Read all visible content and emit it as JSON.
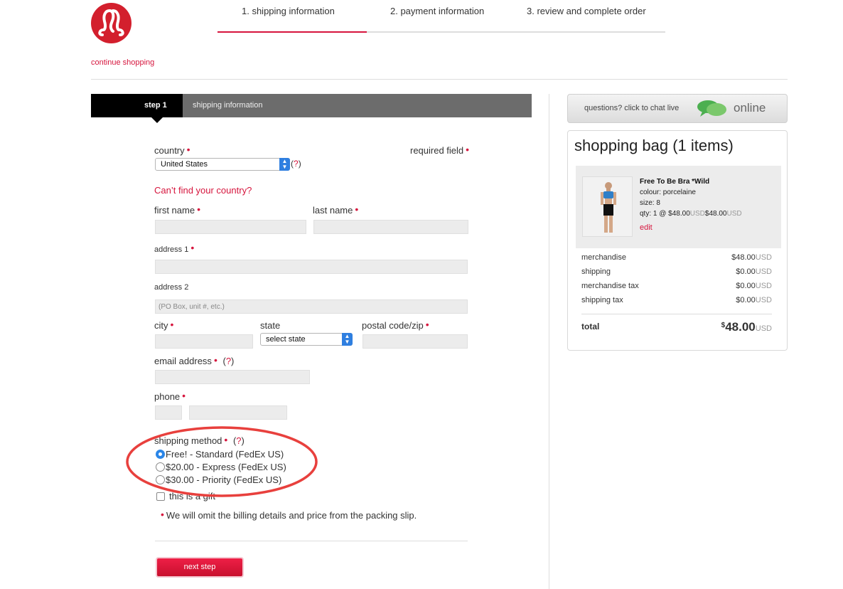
{
  "header": {
    "steps": [
      "1. shipping information",
      "2. payment information",
      "3. review and complete order"
    ],
    "continue_shopping": "continue shopping"
  },
  "stepbar": {
    "step": "step 1",
    "title": "shipping information"
  },
  "form": {
    "country_label": "country",
    "country_value": "United States",
    "help": "(?)",
    "required_field": "required field",
    "cant_find": "Can’t find your country?",
    "first_name": "first name",
    "last_name": "last name",
    "address1": "address 1",
    "address2": "address 2",
    "address2_placeholder": "(PO Box, unit #, etc.)",
    "city": "city",
    "state": "state",
    "state_value": "select state",
    "postal": "postal code/zip",
    "email": "email address",
    "phone": "phone",
    "shipping_method": "shipping method",
    "shipping_options": [
      "Free! - Standard (FedEx US)",
      "$20.00 - Express (FedEx US)",
      "$30.00 - Priority (FedEx US)"
    ],
    "gift": "this is a gift",
    "gift_note": "We will omit the billing details and price from the packing slip.",
    "next_step": "next step"
  },
  "chat": {
    "text": "questions? click to chat live",
    "status": "online"
  },
  "bag": {
    "title": "shopping bag (1 items)",
    "item": {
      "name": "Free To Be Bra *Wild",
      "colour": "colour: porcelaine",
      "size": "size: 8",
      "qty_prefix": "qty: 1 @ $48.00",
      "usd": "USD",
      "line_total": "$48.00",
      "edit": "edit"
    },
    "summary": [
      {
        "label": "merchandise",
        "value": "$48.00"
      },
      {
        "label": "shipping",
        "value": "$0.00"
      },
      {
        "label": "merchandise tax",
        "value": "$0.00"
      },
      {
        "label": "shipping tax",
        "value": "$0.00"
      }
    ],
    "total_label": "total",
    "total_currency": "$",
    "total_value": "48.00",
    "currency": "USD"
  },
  "colors": {
    "accent": "#d6153d",
    "logo": "#d31f2d",
    "annotation": "#e8403d"
  }
}
